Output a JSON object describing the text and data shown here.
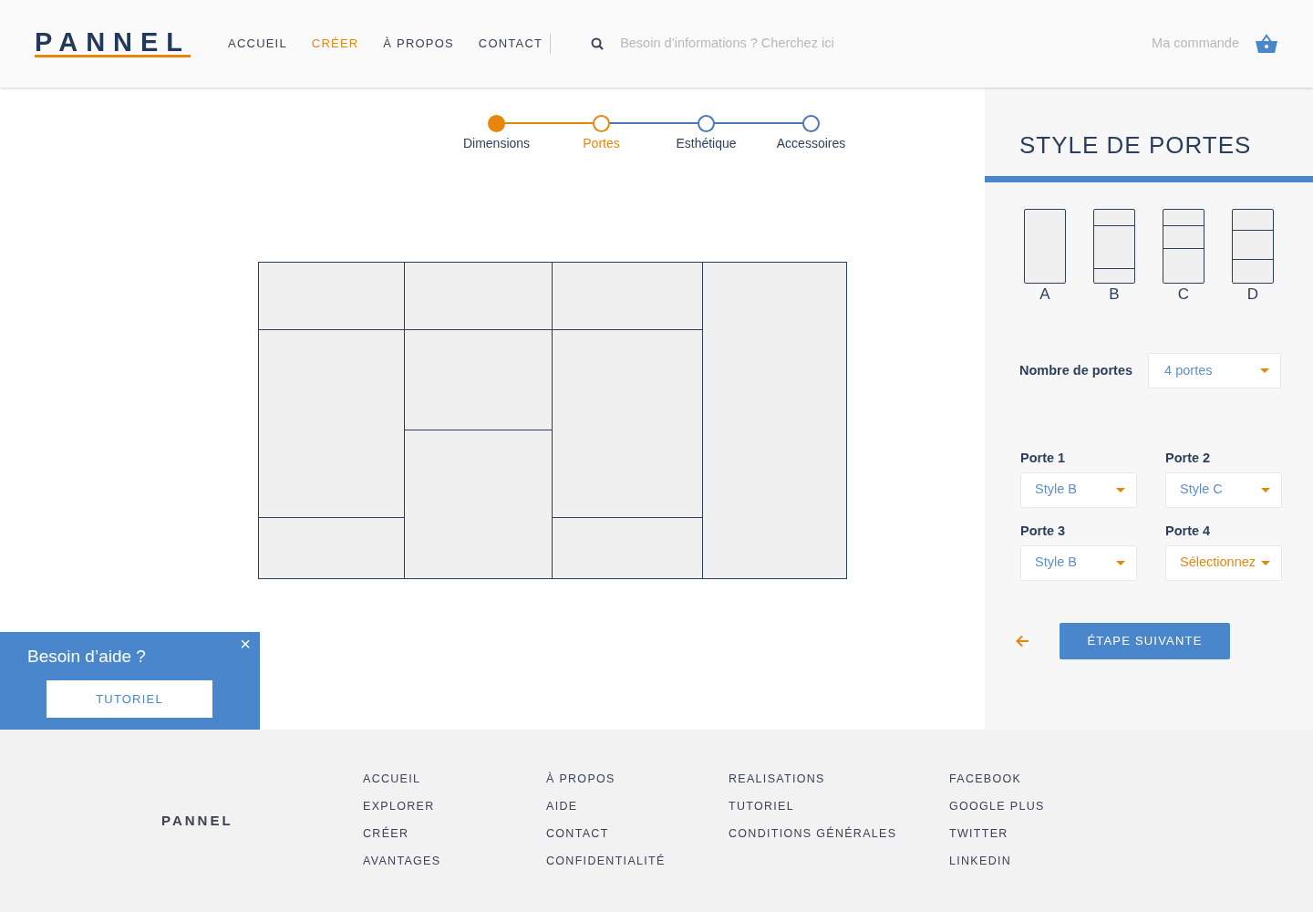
{
  "header": {
    "logo": "PANNEL",
    "nav": [
      {
        "label": "ACCUEIL",
        "selected": false
      },
      {
        "label": "CRÉER",
        "selected": true
      },
      {
        "label": "À PROPOS",
        "selected": false
      },
      {
        "label": "CONTACT",
        "selected": false
      }
    ],
    "search": {
      "placeholder": "Besoin d’informations ? Cherchez ici"
    },
    "order_link": "Ma commande"
  },
  "steps": [
    {
      "label": "Dimensions",
      "kind": "done"
    },
    {
      "label": "Portes",
      "kind": "current"
    },
    {
      "label": "Esthétique",
      "kind": "upcoming"
    },
    {
      "label": "Accessoires",
      "kind": "upcoming"
    }
  ],
  "preview": {
    "doors": [
      {
        "kind": "b"
      },
      {
        "kind": "c"
      },
      {
        "kind": "b"
      },
      {
        "kind": "a"
      }
    ]
  },
  "help_popup": {
    "title": "Besoin d’aide ?",
    "close": "×",
    "button": "TUTORIEL"
  },
  "panel": {
    "title": "STYLE DE PORTES",
    "styles": [
      {
        "label": "A",
        "kind": "a"
      },
      {
        "label": "B",
        "kind": "b"
      },
      {
        "label": "C",
        "kind": "c"
      },
      {
        "label": "D",
        "kind": "d"
      }
    ],
    "door_count": {
      "label": "Nombre de portes",
      "value": "4 portes"
    },
    "doors": [
      {
        "label": "Porte 1",
        "value": "Style B",
        "chosen": true
      },
      {
        "label": "Porte 2",
        "value": "Style C",
        "chosen": true
      },
      {
        "label": "Porte 3",
        "value": "Style B",
        "chosen": true
      },
      {
        "label": "Porte 4",
        "value": "Sélectionnez",
        "chosen": false
      }
    ],
    "next_button": "ÉTAPE SUIVANTE"
  },
  "footer": {
    "logo": "PANNEL",
    "columns": [
      [
        "ACCUEIL",
        "EXPLORER",
        "CRÉER",
        "AVANTAGES"
      ],
      [
        "À PROPOS",
        "AIDE",
        "CONTACT",
        "CONFIDENTIALITÉ"
      ],
      [
        "REALISATIONS",
        "TUTORIEL",
        "CONDITIONS GÉNÉRALES"
      ],
      [
        "FACEBOOK",
        "GOOGLE PLUS",
        "TWITTER",
        "LINKEDIN"
      ]
    ]
  }
}
